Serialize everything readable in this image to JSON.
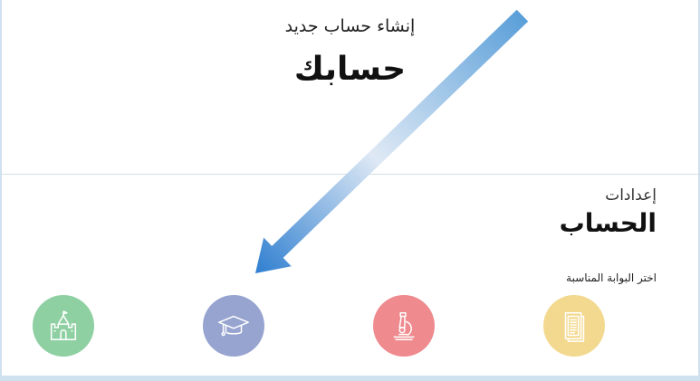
{
  "create_account": {
    "subtitle": "إنشاء حساب جديد",
    "title": "حسابك"
  },
  "account_settings": {
    "subtitle": "إعدادات",
    "title": "الحساب",
    "portal_prompt": "اختر البوابة المناسبة"
  },
  "portals": [
    {
      "icon": "castle-icon",
      "color": "#8fd0a3"
    },
    {
      "icon": "graduation-cap-icon",
      "color": "#97a4d0"
    },
    {
      "icon": "microscope-icon",
      "color": "#ef8a8e"
    },
    {
      "icon": "document-icon",
      "color": "#f3d98f"
    }
  ],
  "colors": {
    "arrow": "#3a86d0",
    "divider": "#d6dde4",
    "frame_border": "#cfe0ef"
  }
}
